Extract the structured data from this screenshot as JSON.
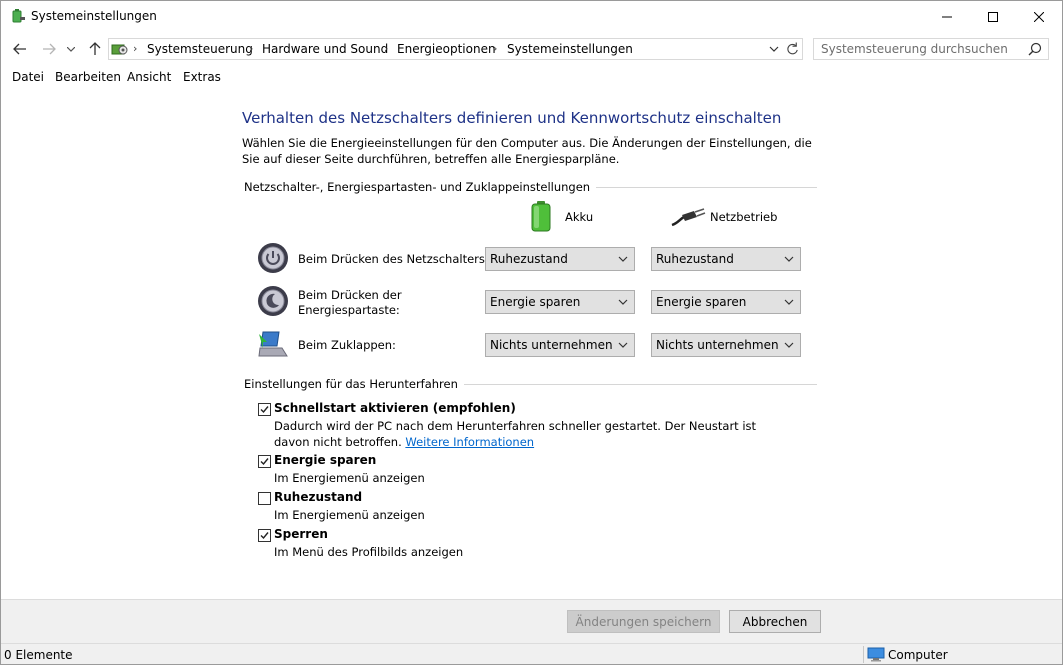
{
  "window": {
    "title": "Systemeinstellungen",
    "controls": [
      "minimize",
      "maximize",
      "close"
    ]
  },
  "nav": {
    "back_icon": "arrow-left-icon",
    "forward_icon": "arrow-right-icon",
    "recent_icon": "chevron-down-icon",
    "up_icon": "arrow-up-icon",
    "breadcrumb": [
      "Systemsteuerung",
      "Hardware und Sound",
      "Energieoptionen",
      "Systemeinstellungen"
    ],
    "search_placeholder": "Systemsteuerung durchsuchen"
  },
  "menu": [
    "Datei",
    "Bearbeiten",
    "Ansicht",
    "Extras"
  ],
  "main": {
    "heading": "Verhalten des Netzschalters definieren und Kennwortschutz einschalten",
    "description": "Wählen Sie die Energieeinstellungen für den Computer aus. Die Änderungen der Einstellungen, die Sie auf dieser Seite durchführen, betreffen alle Energiesparpläne.",
    "section1_title": "Netzschalter-, Energiespartasten- und Zuklappeinstellungen",
    "col_battery": "Akku",
    "col_plugged": "Netzbetrieb",
    "rows": [
      {
        "label": "Beim Drücken des Netzschalters:",
        "battery": "Ruhezustand",
        "plugged": "Ruhezustand",
        "icon": "power-button-icon"
      },
      {
        "label": "Beim Drücken der Energiespartaste:",
        "battery": "Energie sparen",
        "plugged": "Energie sparen",
        "icon": "sleep-button-icon"
      },
      {
        "label": "Beim Zuklappen:",
        "battery": "Nichts unternehmen",
        "plugged": "Nichts unternehmen",
        "icon": "laptop-lid-icon"
      }
    ],
    "section2_title": "Einstellungen für das Herunterfahren",
    "options": [
      {
        "label": "Schnellstart aktivieren (empfohlen)",
        "checked": true,
        "desc": "Dadurch wird der PC nach dem Herunterfahren schneller gestartet. Der Neustart ist davon nicht betroffen.",
        "link": "Weitere Informationen"
      },
      {
        "label": "Energie sparen",
        "checked": true,
        "desc": "Im Energiemenü anzeigen"
      },
      {
        "label": "Ruhezustand",
        "checked": false,
        "desc": "Im Energiemenü anzeigen"
      },
      {
        "label": "Sperren",
        "checked": true,
        "desc": "Im Menü des Profilbilds anzeigen"
      }
    ]
  },
  "footer": {
    "save_label": "Änderungen speichern",
    "cancel_label": "Abbrechen"
  },
  "status": {
    "items": "0 Elemente",
    "location": "Computer"
  },
  "colors": {
    "heading": "#1e3287",
    "link": "#0066cc",
    "accent_battery": "#3aa935"
  }
}
